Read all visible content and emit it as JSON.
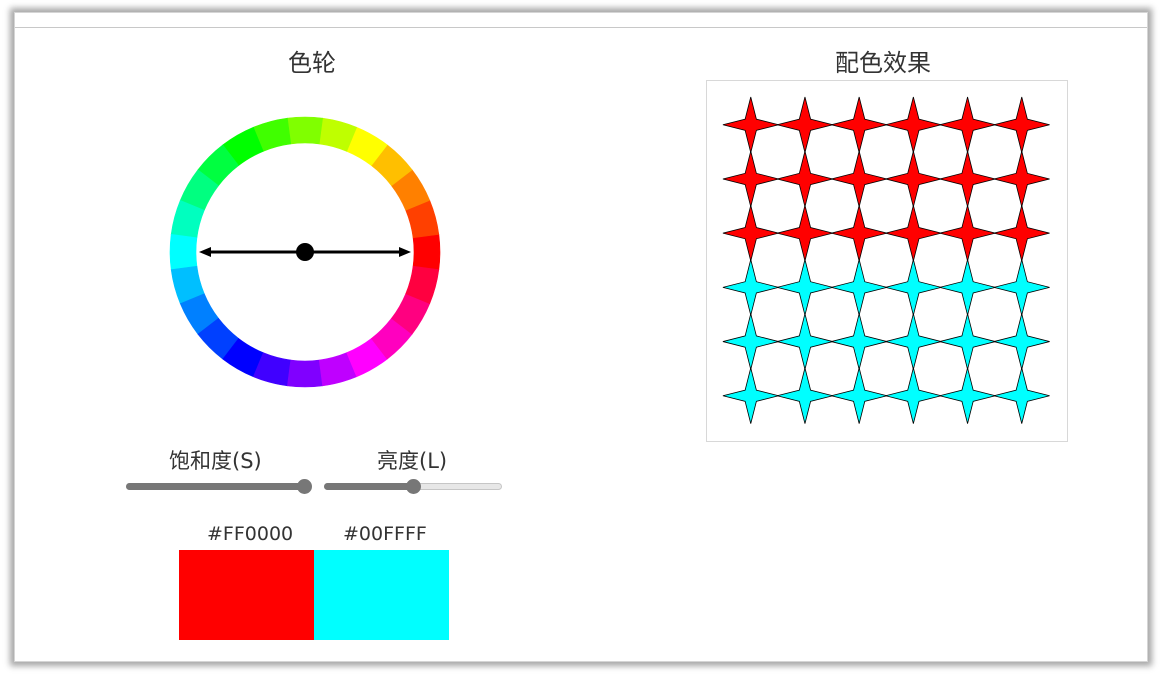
{
  "wheel_panel": {
    "title": "色轮",
    "segment_count": 24,
    "pointer_angle_deg": 0
  },
  "effect_panel": {
    "title": "配色效果",
    "grid_columns": 6,
    "grid_rows": 6,
    "primary_rows": 3
  },
  "saturation": {
    "label": "饱和度(S)",
    "value": 100
  },
  "lightness": {
    "label": "亮度(L)",
    "value": 50
  },
  "swatches": [
    {
      "hex": "#FF0000",
      "color": "#FF0000"
    },
    {
      "hex": "#00FFFF",
      "color": "#00FFFF"
    }
  ],
  "colors": {
    "text": "#333333",
    "slider": "#777777",
    "star_stroke": "#000000"
  }
}
